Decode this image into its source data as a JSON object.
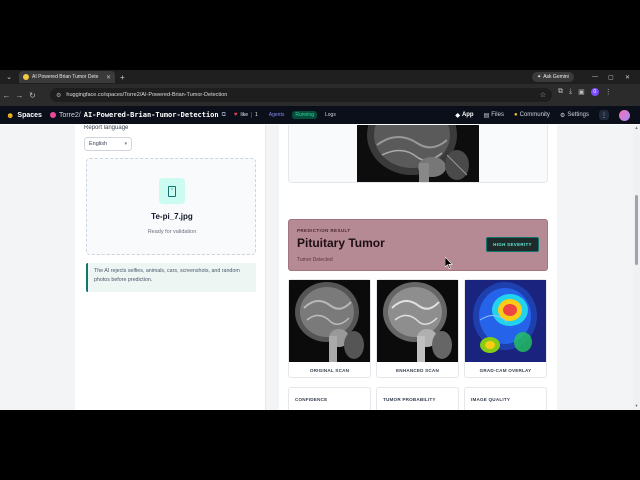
{
  "browser": {
    "tab_title": "AI Powered Brian Tumor Dete",
    "url": "huggingface.co/spaces/Torre2/AI-Powered-Brian-Tumor-Detection",
    "ask_gemini": "Ask Gemini",
    "profile_initial": "0"
  },
  "hf": {
    "logo_text": "Spaces",
    "owner": "Torre2/",
    "repo": "AI-Powered-Brian-Tumor-Detection",
    "like_label": "like",
    "like_count": "1",
    "agents": "Agents",
    "status": "Running",
    "logs": "Logs",
    "nav": {
      "app": "App",
      "files": "Files",
      "community": "Community",
      "settings": "Settings"
    }
  },
  "left": {
    "language_label": "Report language",
    "language_value": "English",
    "file_name": "Te-pi_7.jpg",
    "file_status": "Ready for validation",
    "notice": "The AI rejects selfies, animals, cars, screenshots, and random photos before prediction."
  },
  "result": {
    "label": "PREDICTION RESULT",
    "title": "Pituitary Tumor",
    "subtitle": "Tumor Detected",
    "severity": "HIGH SEVERITY"
  },
  "thumbs": [
    {
      "label": "ORIGINAL SCAN"
    },
    {
      "label": "ENHANCED SCAN"
    },
    {
      "label": "GRAD-CAM OVERLAY"
    }
  ],
  "metrics": [
    {
      "label": "CONFIDENCE"
    },
    {
      "label": "TUMOR PROBABILITY"
    },
    {
      "label": "IMAGE QUALITY"
    }
  ],
  "colors": {
    "accent": "#0f766e",
    "banner": "#b58a94",
    "hf_bar": "#0b0f19"
  }
}
